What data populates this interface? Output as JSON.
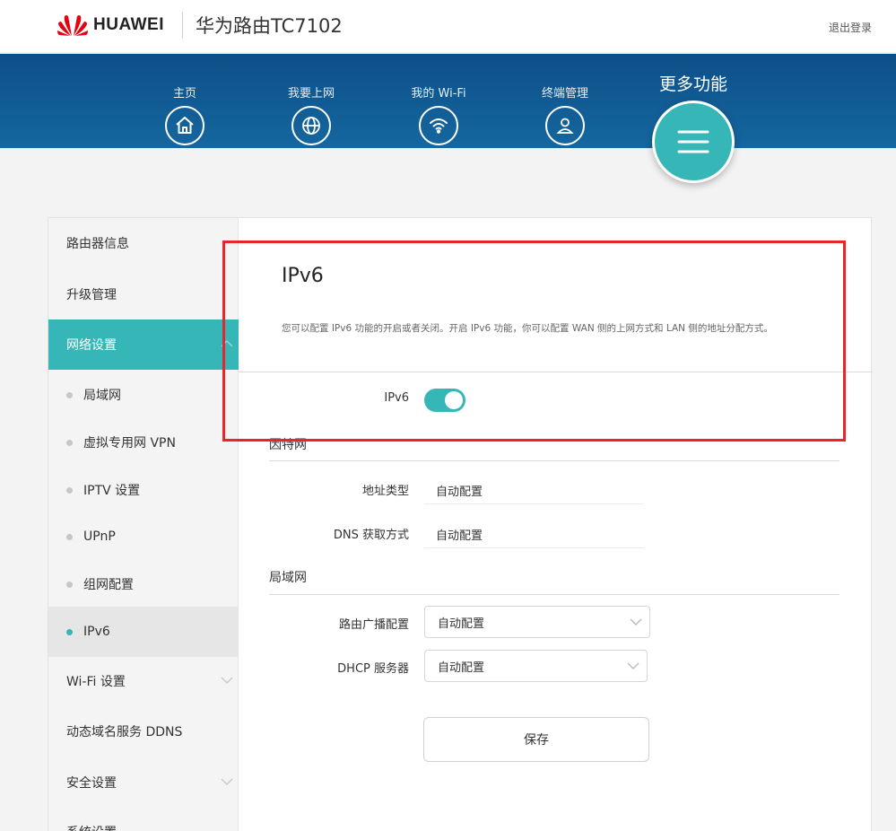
{
  "header": {
    "brand": "HUAWEI",
    "product": "华为路由TC7102",
    "logout": "退出登录",
    "colors": {
      "brand_red": "#e60012"
    }
  },
  "nav": {
    "items": [
      {
        "label": "主页",
        "icon": "home-icon"
      },
      {
        "label": "我要上网",
        "icon": "globe-icon"
      },
      {
        "label": "我的 Wi-Fi",
        "icon": "wifi-icon"
      },
      {
        "label": "终端管理",
        "icon": "user-icon"
      }
    ],
    "more_label": "更多功能",
    "more_icon": "menu-icon",
    "colors": {
      "nav_bg": "#15679f",
      "accent": "#36b6b7"
    }
  },
  "sidebar": {
    "items": [
      {
        "label": "路由器信息"
      },
      {
        "label": "升级管理"
      },
      {
        "label": "网络设置",
        "active": true
      },
      {
        "label": "局域网",
        "sub": true
      },
      {
        "label": "虚拟专用网 VPN",
        "sub": true
      },
      {
        "label": "IPTV 设置",
        "sub": true
      },
      {
        "label": "UPnP",
        "sub": true
      },
      {
        "label": "组网配置",
        "sub": true
      },
      {
        "label": "IPv6",
        "sub": true,
        "current": true
      },
      {
        "label": "Wi-Fi 设置"
      },
      {
        "label": "动态域名服务 DDNS"
      },
      {
        "label": "安全设置"
      },
      {
        "label": "系统设置"
      }
    ]
  },
  "main": {
    "title": "IPv6",
    "description": "您可以配置 IPv6 功能的开启或者关闭。开启 IPv6 功能，你可以配置 WAN 侧的上网方式和 LAN 侧的地址分配方式。",
    "ipv6_label": "IPv6",
    "ipv6_enabled": true,
    "internet": {
      "title": "因特网",
      "address_type_label": "地址类型",
      "address_type_value": "自动配置",
      "dns_label": "DNS 获取方式",
      "dns_value": "自动配置"
    },
    "lan": {
      "title": "局域网",
      "router_advert_label": "路由广播配置",
      "router_advert_value": "自动配置",
      "dhcp_label": "DHCP 服务器",
      "dhcp_value": "自动配置"
    },
    "save_label": "保存"
  }
}
